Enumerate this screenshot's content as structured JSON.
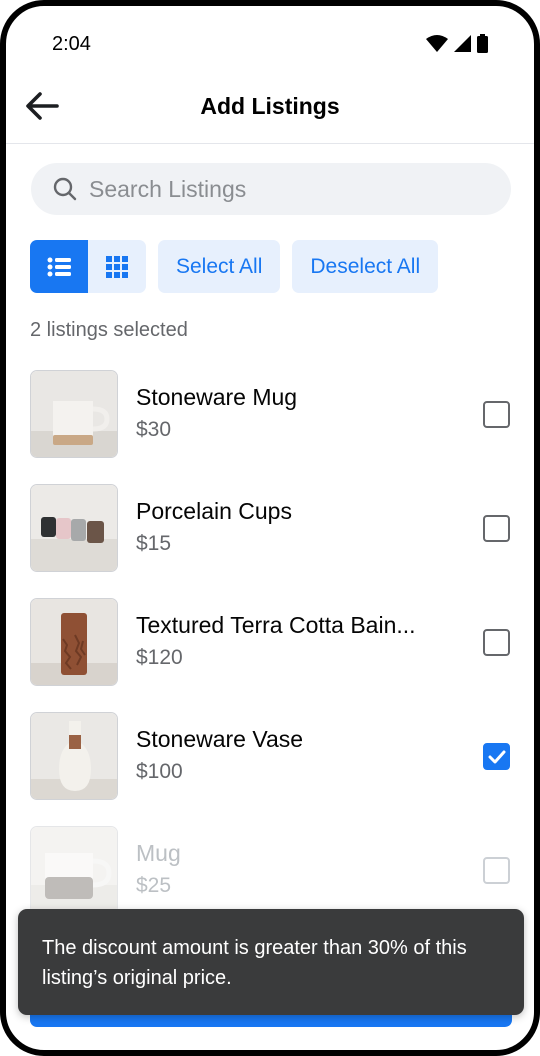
{
  "status_bar": {
    "time": "2:04"
  },
  "header": {
    "title": "Add Listings"
  },
  "search": {
    "placeholder": "Search Listings"
  },
  "toolbar": {
    "select_all": "Select All",
    "deselect_all": "Deselect All"
  },
  "selection": {
    "count_text": "2 listings selected"
  },
  "listings": [
    {
      "name": "Stoneware Mug",
      "price": "$30",
      "checked": false,
      "disabled": false
    },
    {
      "name": "Porcelain Cups",
      "price": "$15",
      "checked": false,
      "disabled": false
    },
    {
      "name": "Textured Terra Cotta Bain...",
      "price": "$120",
      "checked": false,
      "disabled": false
    },
    {
      "name": "Stoneware Vase",
      "price": "$100",
      "checked": true,
      "disabled": false
    },
    {
      "name": "Mug",
      "price": "$25",
      "checked": false,
      "disabled": true
    }
  ],
  "toast": {
    "message": "The discount amount is greater than 30% of this listing’s original price."
  },
  "colors": {
    "accent": "#1877f2",
    "toast_bg": "#3a3b3c",
    "secondary_text": "#65676b"
  }
}
